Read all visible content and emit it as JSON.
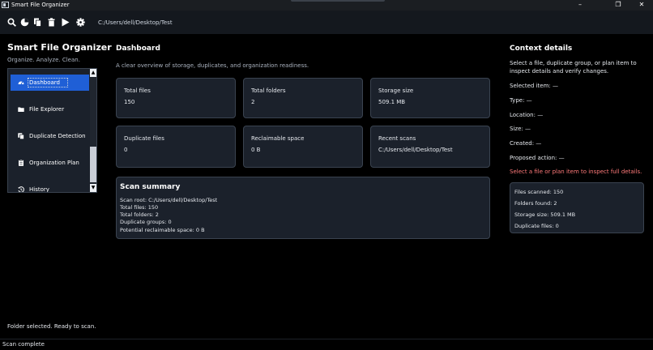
{
  "window": {
    "title": "Smart File Organizer",
    "minimize": "–",
    "maximize": "❐",
    "close": "✕"
  },
  "toolbar": {
    "path": "C:/Users/dell/Desktop/Test",
    "icons": [
      "search-icon",
      "pie-chart-icon",
      "copy-icon",
      "trash-icon",
      "play-icon",
      "gear-icon"
    ]
  },
  "sidebar": {
    "title": "Smart File Organizer",
    "subtitle": "Organize. Analyze. Clean.",
    "items": [
      {
        "label": "Dashboard",
        "icon": "dashboard-icon",
        "active": true
      },
      {
        "label": "File Explorer",
        "icon": "folder-icon"
      },
      {
        "label": "Duplicate Detection",
        "icon": "duplicate-icon"
      },
      {
        "label": "Organization Plan",
        "icon": "clipboard-icon"
      },
      {
        "label": "History",
        "icon": "history-icon"
      }
    ],
    "scroll_up": "▲",
    "scroll_down": "▼",
    "status": "Folder selected. Ready to scan."
  },
  "main": {
    "title": "Dashboard",
    "subtitle": "A clear overview of storage, duplicates, and organization readiness.",
    "cards": [
      {
        "label": "Total files",
        "value": "150"
      },
      {
        "label": "Total folders",
        "value": "2"
      },
      {
        "label": "Storage size",
        "value": "509.1 MB"
      },
      {
        "label": "Duplicate files",
        "value": "0"
      },
      {
        "label": "Reclaimable space",
        "value": "0 B"
      },
      {
        "label": "Recent scans",
        "value": "C:/Users/dell/Desktop/Test"
      }
    ],
    "scan_summary": {
      "title": "Scan summary",
      "lines": [
        "Scan root: C:/Users/dell/Desktop/Test",
        "Total files: 150",
        "Total folders: 2",
        "Duplicate groups: 0",
        "Potential reclaimable space: 0 B"
      ]
    }
  },
  "context": {
    "title": "Context details",
    "description": "Select a file, duplicate group, or plan item to inspect details and verify changes.",
    "fields": [
      "Selected item: —",
      "Type: —",
      "Location: —",
      "Size: —",
      "Created: —",
      "Proposed action: —"
    ],
    "warning": "Select a file or plan item to inspect full details.",
    "stats": [
      "Files scanned: 150",
      "Folders found: 2",
      "Storage size: 509.1 MB",
      "Duplicate files: 0"
    ]
  },
  "statusbar": {
    "text": "Scan complete"
  },
  "colors": {
    "accent": "#1f5fd6",
    "warning": "#ff7a7a",
    "panel": "#1b212b"
  }
}
